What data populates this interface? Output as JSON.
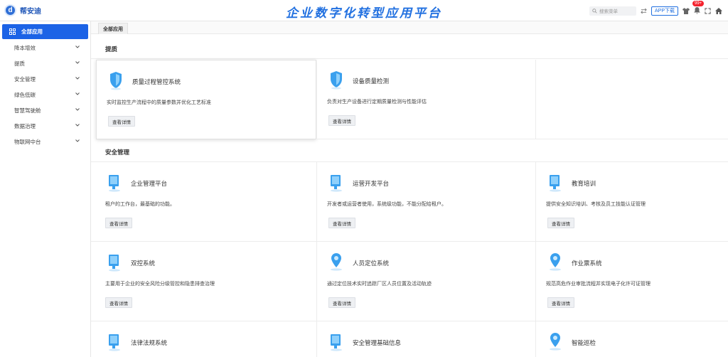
{
  "header": {
    "logo_letter": "d",
    "logo_text": "帮安迪",
    "title": "企业数字化转型应用平台",
    "search_placeholder": "搜索菜单",
    "app_download": "APP下载",
    "notification_badge": "99+"
  },
  "sidebar": {
    "active": "全部应用",
    "items": [
      {
        "label": "降本增效"
      },
      {
        "label": "提质"
      },
      {
        "label": "安全管理"
      },
      {
        "label": "绿色低碳"
      },
      {
        "label": "智慧驾驶舱"
      },
      {
        "label": "数据治理"
      },
      {
        "label": "物联网中台"
      }
    ]
  },
  "tabs": [
    {
      "label": "全部应用"
    }
  ],
  "sections": [
    {
      "title": "提质",
      "cards": [
        {
          "title": "质量过程管控系统",
          "desc": "实时监控生产流程中的质量参数并优化工艺标准",
          "btn": "查看详情"
        },
        {
          "title": "设备质量检测",
          "desc": "负责对生产设备进行定期质量检测与性能评估",
          "btn": "查看详情"
        }
      ]
    },
    {
      "title": "安全管理",
      "cards": [
        {
          "title": "企业管理平台",
          "desc": "租户的工作台，最基础的功能。",
          "btn": "查看详情"
        },
        {
          "title": "运营开发平台",
          "desc": "开发者或运营者使用，系统级功能，不能分配给租户。",
          "btn": "查看详情"
        },
        {
          "title": "教育培训",
          "desc": "提供安全知识培训、考核及员工技能认证管理",
          "btn": "查看详情"
        },
        {
          "title": "双控系统",
          "desc": "主要用于企业的安全风险分级管控和隐患排查治理",
          "btn": "查看详情"
        },
        {
          "title": "人员定位系统",
          "desc": "通过定位技术实时追踪厂区人员位置及活动轨迹",
          "btn": "查看详情"
        },
        {
          "title": "作业票系统",
          "desc": "规范高危作业审批流程并实现电子化许可证管理",
          "btn": "查看详情"
        },
        {
          "title": "法律法规系统"
        },
        {
          "title": "安全管理基础信息"
        },
        {
          "title": "智能巡检"
        }
      ]
    }
  ],
  "colors": {
    "primary": "#1c63e6",
    "title": "#2170e0",
    "badge": "#f5222d"
  }
}
